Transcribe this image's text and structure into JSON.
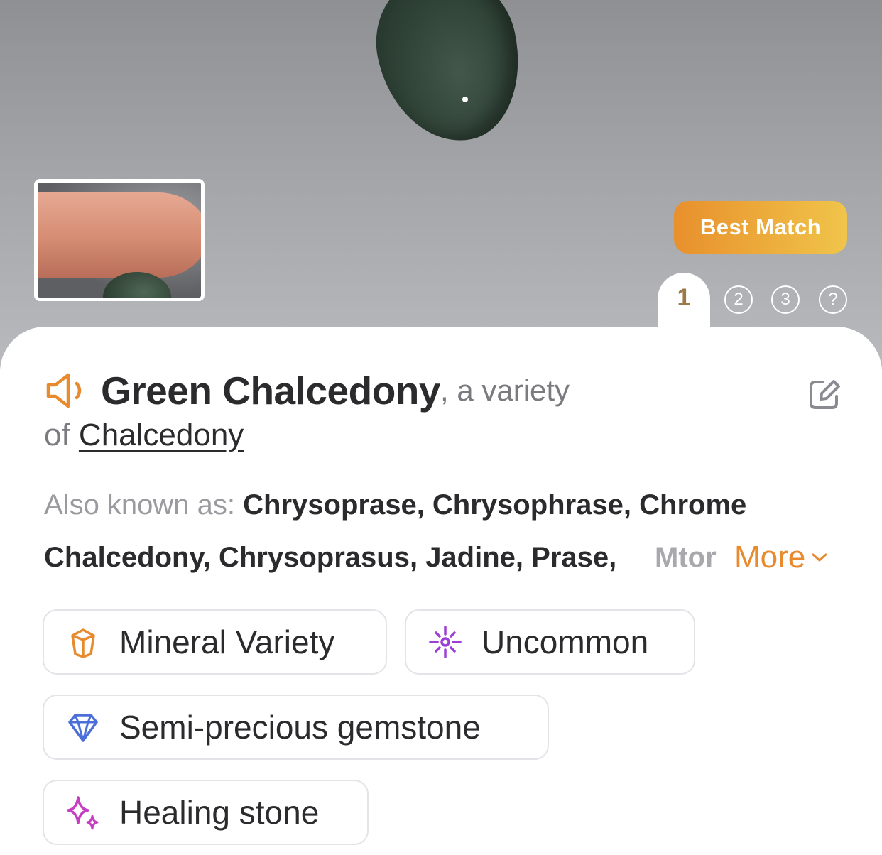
{
  "hero": {
    "badge_label": "Best Match",
    "tabs": [
      "1",
      "2",
      "3",
      "?"
    ],
    "active_tab": "1"
  },
  "result": {
    "name": "Green Chalcedony",
    "variety_text": ", a variety",
    "of_text": "of ",
    "parent": "Chalcedony"
  },
  "aka": {
    "label": "Also known as: ",
    "values": "Chrysoprase, Chrysophrase, Chrome Chalcedony, Chrysoprasus, Jadine, Prase, ",
    "faded": "Mtor",
    "more_label": "More"
  },
  "tags": [
    {
      "label": "Mineral Variety",
      "icon": "crystal-icon",
      "color": "#e88a2e"
    },
    {
      "label": "Uncommon",
      "icon": "sparkle-burst-icon",
      "color": "#9b3fd6"
    },
    {
      "label": "Semi-precious gemstone",
      "icon": "diamond-icon",
      "color": "#4a6fd8"
    },
    {
      "label": "Healing stone",
      "icon": "sparkles-icon",
      "color": "#c63fc2"
    }
  ],
  "colors": {
    "accent": "#e88a2e",
    "badge_gradient_start": "#e8902c",
    "badge_gradient_end": "#f0c44a",
    "active_tab_text": "#9b7a47"
  }
}
